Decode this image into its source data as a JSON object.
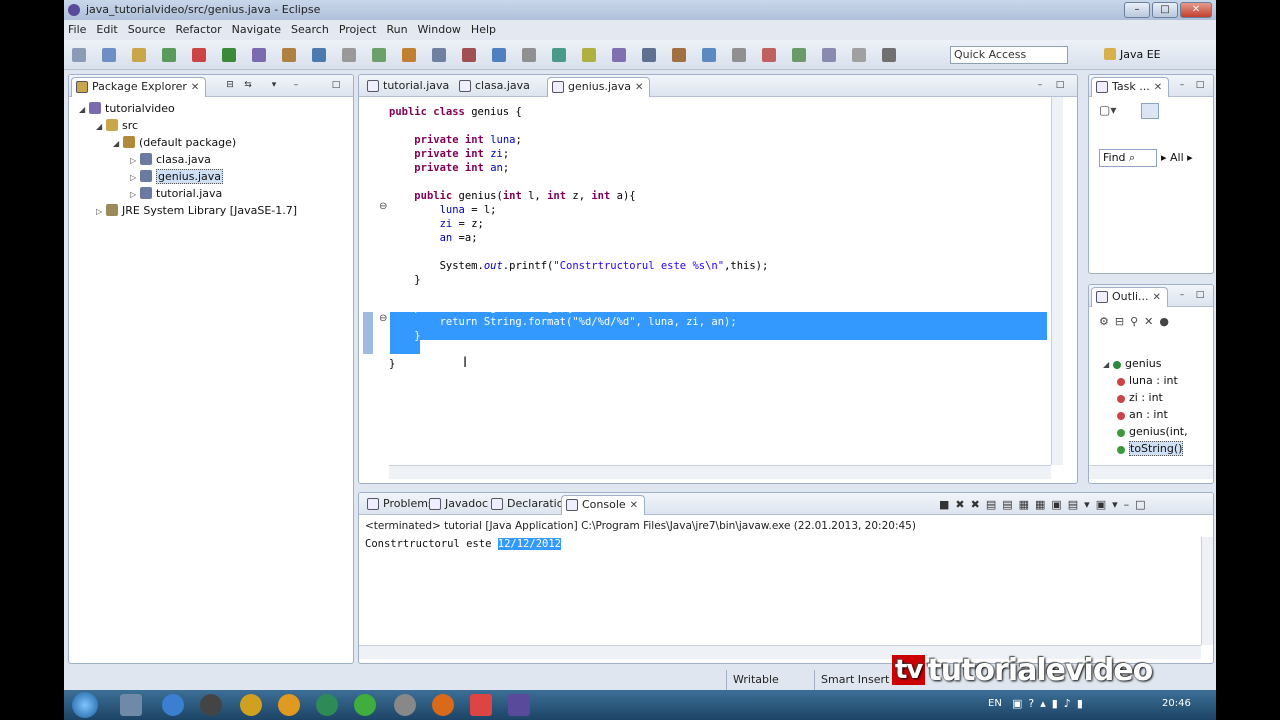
{
  "window": {
    "title": "java_tutorialvideo/src/genius.java - Eclipse",
    "title_prefix": "java - tutorialvideo/src/genius.java - Eclipse"
  },
  "menu": [
    "File",
    "Edit",
    "Source",
    "Refactor",
    "Navigate",
    "Search",
    "Project",
    "Run",
    "Window",
    "Help"
  ],
  "toolbar": {
    "quick_access": "Quick Access",
    "perspective": "Java EE"
  },
  "package_explorer": {
    "tab": "Package Explorer",
    "tree": [
      {
        "label": "tutorialvideo",
        "level": 0,
        "expanded": true
      },
      {
        "label": "src",
        "level": 1,
        "expanded": true
      },
      {
        "label": "(default package)",
        "level": 2,
        "expanded": true
      },
      {
        "label": "clasa.java",
        "level": 3,
        "expanded": false
      },
      {
        "label": "genius.java",
        "level": 3,
        "expanded": false,
        "selected": true
      },
      {
        "label": "tutorial.java",
        "level": 3,
        "expanded": false
      },
      {
        "label": "JRE System Library [JavaSE-1.7]",
        "level": 1,
        "expanded": false
      }
    ]
  },
  "editor": {
    "tabs": [
      {
        "label": "tutorial.java"
      },
      {
        "label": "clasa.java"
      },
      {
        "label": "genius.java",
        "active": true
      }
    ],
    "lines": [
      "public class genius {",
      "",
      "    private int luna;",
      "    private int zi;",
      "    private int an;",
      "",
      "    public genius(int l, int z, int a){",
      "        luna = l;",
      "        zi = z;",
      "        an =a;",
      "",
      "        System.out.printf(\"Constrtructorul este %s\\n\",this);",
      "    }",
      "",
      "    public String toString(){",
      "        return String.format(\"%d/%d/%d\", luna, zi, an);",
      "    }",
      "",
      "}"
    ]
  },
  "task_list": {
    "tab": "Task ...",
    "find": "Find",
    "all": "All"
  },
  "outline": {
    "tab": "Outli...",
    "items": [
      {
        "label": "genius",
        "level": 0
      },
      {
        "label": "luna : int",
        "level": 1
      },
      {
        "label": "zi : int",
        "level": 1
      },
      {
        "label": "an : int",
        "level": 1
      },
      {
        "label": "genius(int,",
        "level": 1
      },
      {
        "label": "toString()",
        "level": 1,
        "selected": true
      }
    ]
  },
  "bottom": {
    "tabs": [
      {
        "label": "Problems"
      },
      {
        "label": "Javadoc"
      },
      {
        "label": "Declaration"
      },
      {
        "label": "Console",
        "active": true
      }
    ],
    "status": "<terminated> tutorial [Java Application] C:\\Program Files\\Java\\jre7\\bin\\javaw.exe (22.01.2013, 20:20:45)",
    "output_text": "Constrtructorul este ",
    "output_selected": "12/12/2012"
  },
  "statusbar": {
    "writable": "Writable",
    "insert": "Smart Insert"
  },
  "watermark": {
    "tv": "tv",
    "text": "tutorialevideo"
  },
  "taskbar": {
    "lang": "EN",
    "time": "20:46"
  },
  "colors": {
    "selection": "#3399ff",
    "keyword": "#7f0055",
    "string": "#2a00ff",
    "field": "#0000c0",
    "panel_border": "#9fb0c8",
    "taskbar": "#1c4466"
  }
}
